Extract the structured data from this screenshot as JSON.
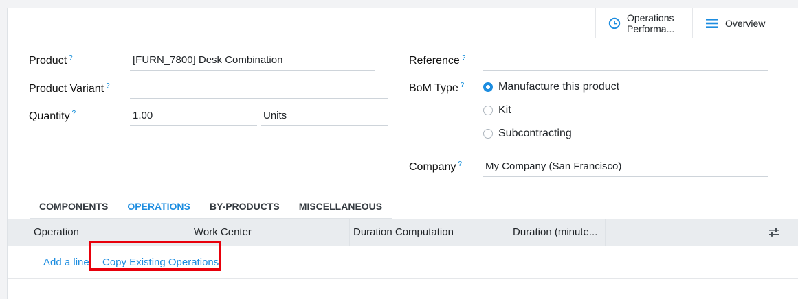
{
  "smart_buttons": {
    "operations_line1": "Operations",
    "operations_line2": "Performa...",
    "overview": "Overview"
  },
  "form": {
    "product_label": "Product",
    "product_value": "[FURN_7800] Desk Combination",
    "variant_label": "Product Variant",
    "variant_value": "",
    "quantity_label": "Quantity",
    "quantity_value": "1.00",
    "uom_value": "Units",
    "reference_label": "Reference",
    "reference_value": "",
    "bom_type_label": "BoM Type",
    "bom_types": [
      "Manufacture this product",
      "Kit",
      "Subcontracting"
    ],
    "bom_type_selected": "Manufacture this product",
    "company_label": "Company",
    "company_value": "My Company (San Francisco)",
    "help_mark": "?"
  },
  "tabs": [
    "COMPONENTS",
    "OPERATIONS",
    "BY-PRODUCTS",
    "MISCELLANEOUS"
  ],
  "active_tab": "OPERATIONS",
  "table": {
    "columns": [
      "Operation",
      "Work Center",
      "Duration Computation",
      "Duration (minute..."
    ]
  },
  "actions": {
    "add_line": "Add a line",
    "copy_operations": "Copy Existing Operations"
  },
  "colors": {
    "accent": "#1d8de0",
    "highlight": "#e8000b"
  }
}
